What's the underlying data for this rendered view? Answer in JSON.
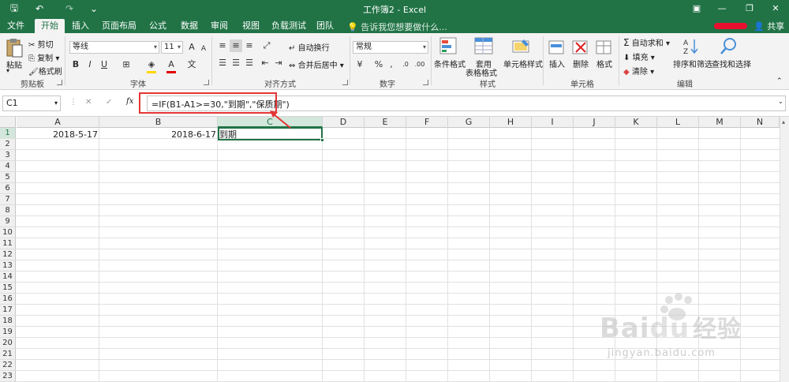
{
  "window": {
    "title": "工作簿2 - Excel",
    "quick_access": {
      "save": "🖫",
      "undo": "↶",
      "redo": "↷",
      "customize": "⌄"
    },
    "controls": {
      "ribbon_options": "▣",
      "minimize": "—",
      "restore": "❐",
      "close": "✕"
    }
  },
  "tabs": [
    "文件",
    "开始",
    "插入",
    "页面布局",
    "公式",
    "数据",
    "审阅",
    "视图",
    "负载测试",
    "团队"
  ],
  "active_tab": "开始",
  "tell_me": "告诉我您想要做什么...",
  "share": "共享",
  "ribbon": {
    "clipboard": {
      "paste": "粘贴",
      "cut": "剪切",
      "copy": "复制",
      "format_painter": "格式刷",
      "label": "剪贴板"
    },
    "font": {
      "name": "等线",
      "size": "11",
      "grow": "A",
      "shrink": "A",
      "bold": "B",
      "italic": "I",
      "underline": "U",
      "font_color": "A",
      "label": "字体"
    },
    "alignment": {
      "wrap": "自动换行",
      "merge": "合并后居中",
      "label": "对齐方式"
    },
    "number": {
      "format": "常规",
      "percent": "%",
      "comma": ",",
      "label": "数字"
    },
    "styles": {
      "conditional": "条件格式",
      "table_line1": "套用",
      "table_line2": "表格格式",
      "cell_styles": "单元格样式",
      "label": "样式"
    },
    "cells": {
      "insert": "插入",
      "delete": "删除",
      "format": "格式",
      "label": "单元格"
    },
    "editing": {
      "autosum": "自动求和",
      "fill": "填充",
      "clear": "清除",
      "sort": "排序和筛选",
      "find": "查找和选择",
      "label": "编辑"
    }
  },
  "formula_bar": {
    "name_box": "C1",
    "fx": "fx",
    "cancel": "✕",
    "enter": "✓",
    "formula": "=IF(B1-A1>=30,\"到期\",\"保质期\")"
  },
  "sheet": {
    "columns": [
      "A",
      "B",
      "C",
      "D",
      "E",
      "F",
      "G",
      "H",
      "I",
      "J",
      "K",
      "L",
      "M",
      "N"
    ],
    "rows": [
      "1",
      "2",
      "3",
      "4",
      "5",
      "6",
      "7",
      "8",
      "9",
      "10",
      "11",
      "12",
      "13",
      "14",
      "15",
      "16",
      "17",
      "18",
      "19",
      "20",
      "21",
      "22",
      "23"
    ],
    "cells": {
      "A1": "2018-5-17",
      "B1": "2018-6-17",
      "C1": "到期"
    },
    "active_cell": "C1"
  },
  "watermark": {
    "brand": "Bai",
    "brand2": "du",
    "cn": "经验",
    "url": "jingyan.baidu.com"
  },
  "colors": {
    "accent": "#217346",
    "highlight": "#e53535"
  }
}
